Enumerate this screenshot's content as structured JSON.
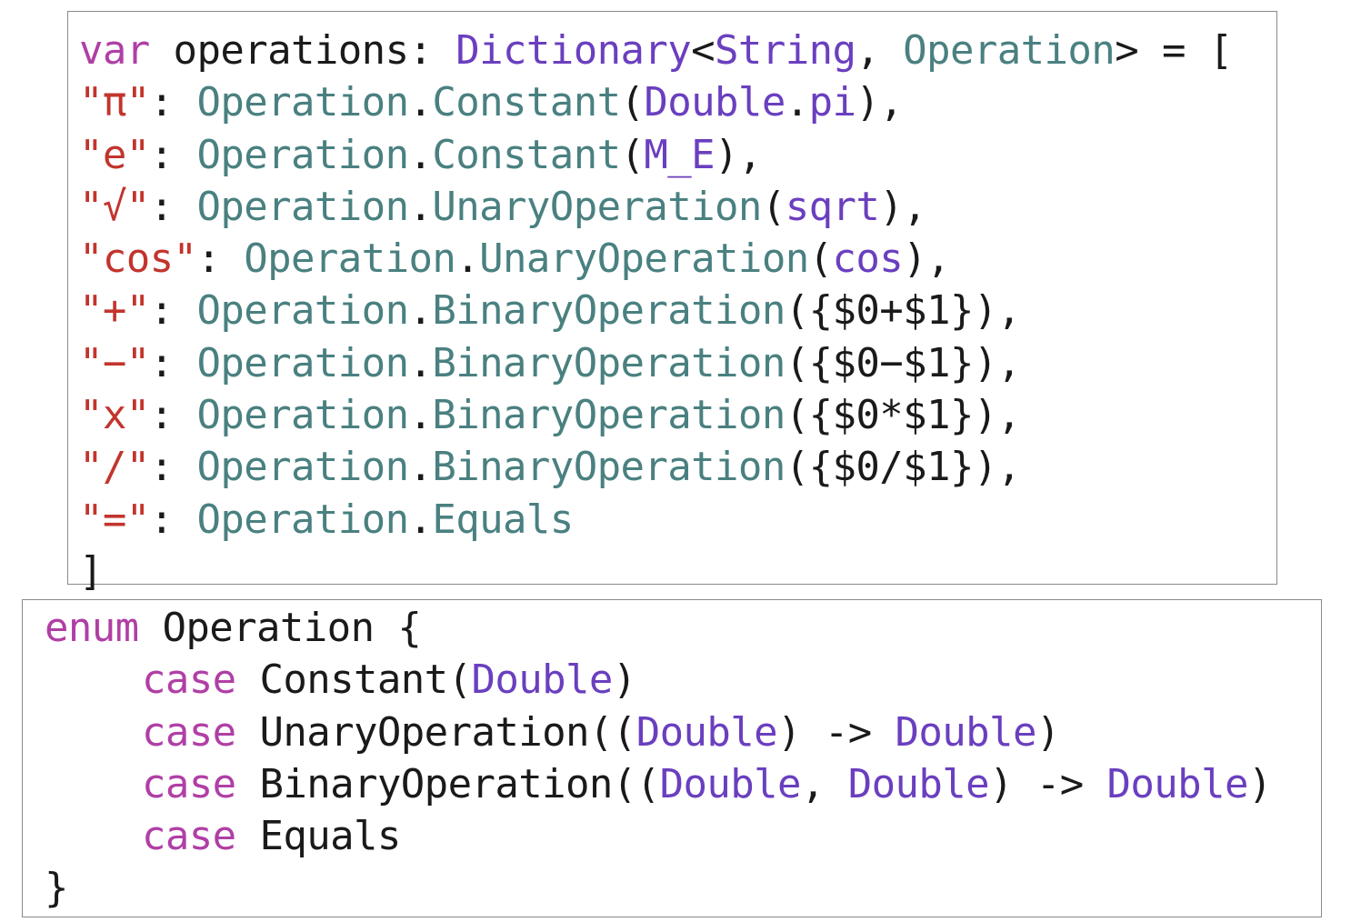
{
  "colors": {
    "keyword": "#b03fa5",
    "type": "#6a3fbf",
    "class": "#4a8080",
    "string": "#c2342d",
    "plain": "#1a1a1a",
    "border": "#8a8a8a"
  },
  "dictionary_block": {
    "lines": [
      [
        {
          "t": "var",
          "c": "kw"
        },
        {
          "t": " operations: ",
          "c": "plain"
        },
        {
          "t": "Dictionary",
          "c": "type"
        },
        {
          "t": "<",
          "c": "plain"
        },
        {
          "t": "String",
          "c": "type"
        },
        {
          "t": ", ",
          "c": "plain"
        },
        {
          "t": "Operation",
          "c": "class"
        },
        {
          "t": "> = [",
          "c": "plain"
        }
      ],
      [
        {
          "t": "\"π\"",
          "c": "str"
        },
        {
          "t": ": ",
          "c": "plain"
        },
        {
          "t": "Operation",
          "c": "class"
        },
        {
          "t": ".",
          "c": "plain"
        },
        {
          "t": "Constant",
          "c": "class"
        },
        {
          "t": "(",
          "c": "plain"
        },
        {
          "t": "Double",
          "c": "type"
        },
        {
          "t": ".",
          "c": "plain"
        },
        {
          "t": "pi",
          "c": "type"
        },
        {
          "t": "),",
          "c": "plain"
        }
      ],
      [
        {
          "t": "\"e\"",
          "c": "str"
        },
        {
          "t": ": ",
          "c": "plain"
        },
        {
          "t": "Operation",
          "c": "class"
        },
        {
          "t": ".",
          "c": "plain"
        },
        {
          "t": "Constant",
          "c": "class"
        },
        {
          "t": "(",
          "c": "plain"
        },
        {
          "t": "M_E",
          "c": "type"
        },
        {
          "t": "),",
          "c": "plain"
        }
      ],
      [
        {
          "t": "\"√\"",
          "c": "str"
        },
        {
          "t": ": ",
          "c": "plain"
        },
        {
          "t": "Operation",
          "c": "class"
        },
        {
          "t": ".",
          "c": "plain"
        },
        {
          "t": "UnaryOperation",
          "c": "class"
        },
        {
          "t": "(",
          "c": "plain"
        },
        {
          "t": "sqrt",
          "c": "type"
        },
        {
          "t": "),",
          "c": "plain"
        }
      ],
      [
        {
          "t": "\"cos\"",
          "c": "str"
        },
        {
          "t": ": ",
          "c": "plain"
        },
        {
          "t": "Operation",
          "c": "class"
        },
        {
          "t": ".",
          "c": "plain"
        },
        {
          "t": "UnaryOperation",
          "c": "class"
        },
        {
          "t": "(",
          "c": "plain"
        },
        {
          "t": "cos",
          "c": "type"
        },
        {
          "t": "),",
          "c": "plain"
        }
      ],
      [
        {
          "t": "\"+\"",
          "c": "str"
        },
        {
          "t": ": ",
          "c": "plain"
        },
        {
          "t": "Operation",
          "c": "class"
        },
        {
          "t": ".",
          "c": "plain"
        },
        {
          "t": "BinaryOperation",
          "c": "class"
        },
        {
          "t": "({$0+$1}),",
          "c": "plain"
        }
      ],
      [
        {
          "t": "\"−\"",
          "c": "str"
        },
        {
          "t": ": ",
          "c": "plain"
        },
        {
          "t": "Operation",
          "c": "class"
        },
        {
          "t": ".",
          "c": "plain"
        },
        {
          "t": "BinaryOperation",
          "c": "class"
        },
        {
          "t": "({$0−$1}),",
          "c": "plain"
        }
      ],
      [
        {
          "t": "\"x\"",
          "c": "str"
        },
        {
          "t": ": ",
          "c": "plain"
        },
        {
          "t": "Operation",
          "c": "class"
        },
        {
          "t": ".",
          "c": "plain"
        },
        {
          "t": "BinaryOperation",
          "c": "class"
        },
        {
          "t": "({$0*$1}),",
          "c": "plain"
        }
      ],
      [
        {
          "t": "\"/\"",
          "c": "str"
        },
        {
          "t": ": ",
          "c": "plain"
        },
        {
          "t": "Operation",
          "c": "class"
        },
        {
          "t": ".",
          "c": "plain"
        },
        {
          "t": "BinaryOperation",
          "c": "class"
        },
        {
          "t": "({$0/$1}),",
          "c": "plain"
        }
      ],
      [
        {
          "t": "\"=\"",
          "c": "str"
        },
        {
          "t": ": ",
          "c": "plain"
        },
        {
          "t": "Operation",
          "c": "class"
        },
        {
          "t": ".",
          "c": "plain"
        },
        {
          "t": "Equals",
          "c": "class"
        }
      ],
      [
        {
          "t": "]",
          "c": "plain"
        }
      ]
    ]
  },
  "enum_block": {
    "lines": [
      {
        "indent": false,
        "tokens": [
          {
            "t": "enum",
            "c": "kw"
          },
          {
            "t": " Operation {",
            "c": "plain"
          }
        ]
      },
      {
        "indent": true,
        "tokens": [
          {
            "t": "case",
            "c": "kw"
          },
          {
            "t": " Constant(",
            "c": "plain"
          },
          {
            "t": "Double",
            "c": "type"
          },
          {
            "t": ")",
            "c": "plain"
          }
        ]
      },
      {
        "indent": true,
        "tokens": [
          {
            "t": "case",
            "c": "kw"
          },
          {
            "t": " UnaryOperation((",
            "c": "plain"
          },
          {
            "t": "Double",
            "c": "type"
          },
          {
            "t": ") -> ",
            "c": "plain"
          },
          {
            "t": "Double",
            "c": "type"
          },
          {
            "t": ")",
            "c": "plain"
          }
        ]
      },
      {
        "indent": true,
        "tokens": [
          {
            "t": "case",
            "c": "kw"
          },
          {
            "t": " BinaryOperation((",
            "c": "plain"
          },
          {
            "t": "Double",
            "c": "type"
          },
          {
            "t": ", ",
            "c": "plain"
          },
          {
            "t": "Double",
            "c": "type"
          },
          {
            "t": ") -> ",
            "c": "plain"
          },
          {
            "t": "Double",
            "c": "type"
          },
          {
            "t": ")",
            "c": "plain"
          }
        ]
      },
      {
        "indent": true,
        "tokens": [
          {
            "t": "case",
            "c": "kw"
          },
          {
            "t": " Equals",
            "c": "plain"
          }
        ]
      },
      {
        "indent": false,
        "tokens": [
          {
            "t": "}",
            "c": "plain"
          }
        ]
      }
    ]
  }
}
